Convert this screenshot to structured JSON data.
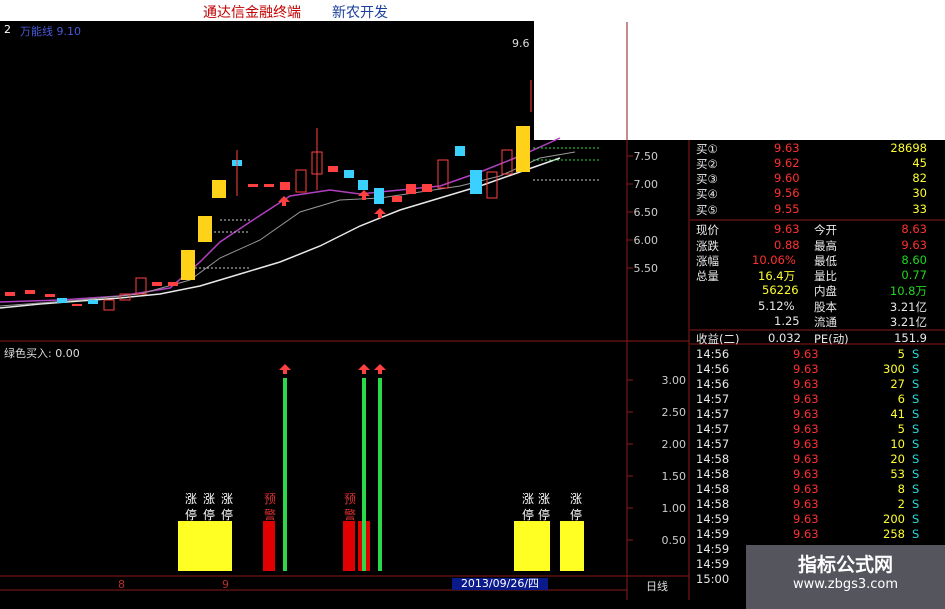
{
  "title": {
    "app": "通达信金融终端",
    "edition": "新农开发"
  },
  "panel": {
    "code": "2",
    "name": "万能线",
    "param": "9.10",
    "top_price": "9.6"
  },
  "price_axis": [
    "7.50",
    "7.00",
    "6.50",
    "6.00",
    "5.50"
  ],
  "indicator": {
    "label": "绿色买入: 0.00",
    "axis": [
      "3.00",
      "2.50",
      "2.00",
      "1.50",
      "1.00",
      "0.50"
    ]
  },
  "order_book": [
    {
      "label": "买①",
      "price": "9.63",
      "vol": "28698"
    },
    {
      "label": "买②",
      "price": "9.62",
      "vol": "45"
    },
    {
      "label": "买③",
      "price": "9.60",
      "vol": "82"
    },
    {
      "label": "买④",
      "price": "9.56",
      "vol": "30"
    },
    {
      "label": "买⑤",
      "price": "9.55",
      "vol": "33"
    }
  ],
  "quote": {
    "now_label": "现价",
    "now": "9.63",
    "open_label": "今开",
    "open": "8.63",
    "chg_label": "涨跌",
    "chg": "0.88",
    "high_label": "最高",
    "high": "9.63",
    "pct_label": "涨幅",
    "pct": "10.06%",
    "low_label": "最低",
    "low": "8.60",
    "vol_label": "总量",
    "vol": "16.4万",
    "ratio_label": "量比",
    "ratio": "0.77",
    "inner": "56226",
    "inner_label": "内盘",
    "inner_val": "10.8万",
    "turnover": "5.12%",
    "cap_label": "股本",
    "cap": "3.21亿",
    "pb": "1.25",
    "float_label": "流通",
    "float": "3.21亿",
    "eps_label": "收益(二)",
    "eps": "0.032",
    "pe_label": "PE(动)",
    "pe": "151.9"
  },
  "ticks": [
    {
      "time": "14:56",
      "price": "9.63",
      "vol": "5",
      "side": "S"
    },
    {
      "time": "14:56",
      "price": "9.63",
      "vol": "300",
      "side": "S"
    },
    {
      "time": "14:56",
      "price": "9.63",
      "vol": "27",
      "side": "S"
    },
    {
      "time": "14:57",
      "price": "9.63",
      "vol": "6",
      "side": "S"
    },
    {
      "time": "14:57",
      "price": "9.63",
      "vol": "41",
      "side": "S"
    },
    {
      "time": "14:57",
      "price": "9.63",
      "vol": "5",
      "side": "S"
    },
    {
      "time": "14:57",
      "price": "9.63",
      "vol": "10",
      "side": "S"
    },
    {
      "time": "14:58",
      "price": "9.63",
      "vol": "20",
      "side": "S"
    },
    {
      "time": "14:58",
      "price": "9.63",
      "vol": "53",
      "side": "S"
    },
    {
      "time": "14:58",
      "price": "9.63",
      "vol": "8",
      "side": "S"
    },
    {
      "time": "14:58",
      "price": "9.63",
      "vol": "2",
      "side": "S"
    },
    {
      "time": "14:59",
      "price": "9.63",
      "vol": "200",
      "side": "S"
    },
    {
      "time": "14:59",
      "price": "9.63",
      "vol": "258",
      "side": "S"
    },
    {
      "time": "14:59",
      "price": "",
      "vol": "",
      "side": ""
    },
    {
      "time": "14:59",
      "price": "",
      "vol": "",
      "side": ""
    },
    {
      "time": "15:00",
      "price": "",
      "vol": "",
      "side": ""
    }
  ],
  "timeline": {
    "date": "2013/09/26/四",
    "period": "日线",
    "tick8": "8",
    "tick9": "9"
  },
  "signals": {
    "up": "涨",
    "stop": "停",
    "pre": "预",
    "warn": "警"
  },
  "watermark": {
    "line1": "指标公式网",
    "line2": "www.zbgs3.com"
  }
}
